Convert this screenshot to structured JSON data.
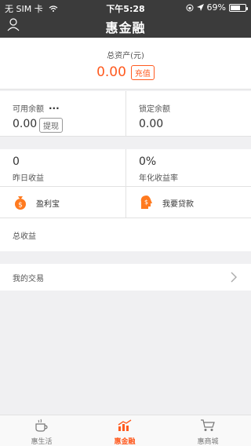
{
  "status_bar": {
    "carrier": "无 SIM 卡",
    "time": "下午5:28",
    "battery": "69%",
    "battery_level": 0.69,
    "icons": [
      "wifi-icon",
      "location-arrow-icon",
      "lock-rotation-icon",
      "battery-icon"
    ]
  },
  "nav": {
    "title": "惠金融",
    "left_icon": "user-icon"
  },
  "total": {
    "label": "总资产(元)",
    "value": "0.00",
    "recharge_label": "充值"
  },
  "balances": {
    "available_label": "可用余额",
    "available_dots": "...",
    "available_value": "0.00",
    "withdraw_label": "提现",
    "locked_label": "锁定余额",
    "locked_value": "0.00"
  },
  "stats": {
    "yesterday_value": "0",
    "yesterday_label": "昨日收益",
    "rate_value": "0%",
    "rate_label": "年化收益率",
    "product1_label": "盈利宝",
    "product1_icon": "money-bag-icon",
    "product2_label": "我要贷款",
    "product2_icon": "person-dollar-icon",
    "total_income_label": "总收益"
  },
  "trade": {
    "label": "我的交易",
    "icon": "chevron-right-icon"
  },
  "tabs": [
    {
      "label": "惠生活",
      "icon": "coffee-cup-icon",
      "active": false
    },
    {
      "label": "惠金融",
      "icon": "chart-icon",
      "active": true
    },
    {
      "label": "惠商城",
      "icon": "cart-icon",
      "active": false
    }
  ],
  "colors": {
    "accent": "#ff5a1f",
    "header_bg": "#3b3b3b"
  }
}
